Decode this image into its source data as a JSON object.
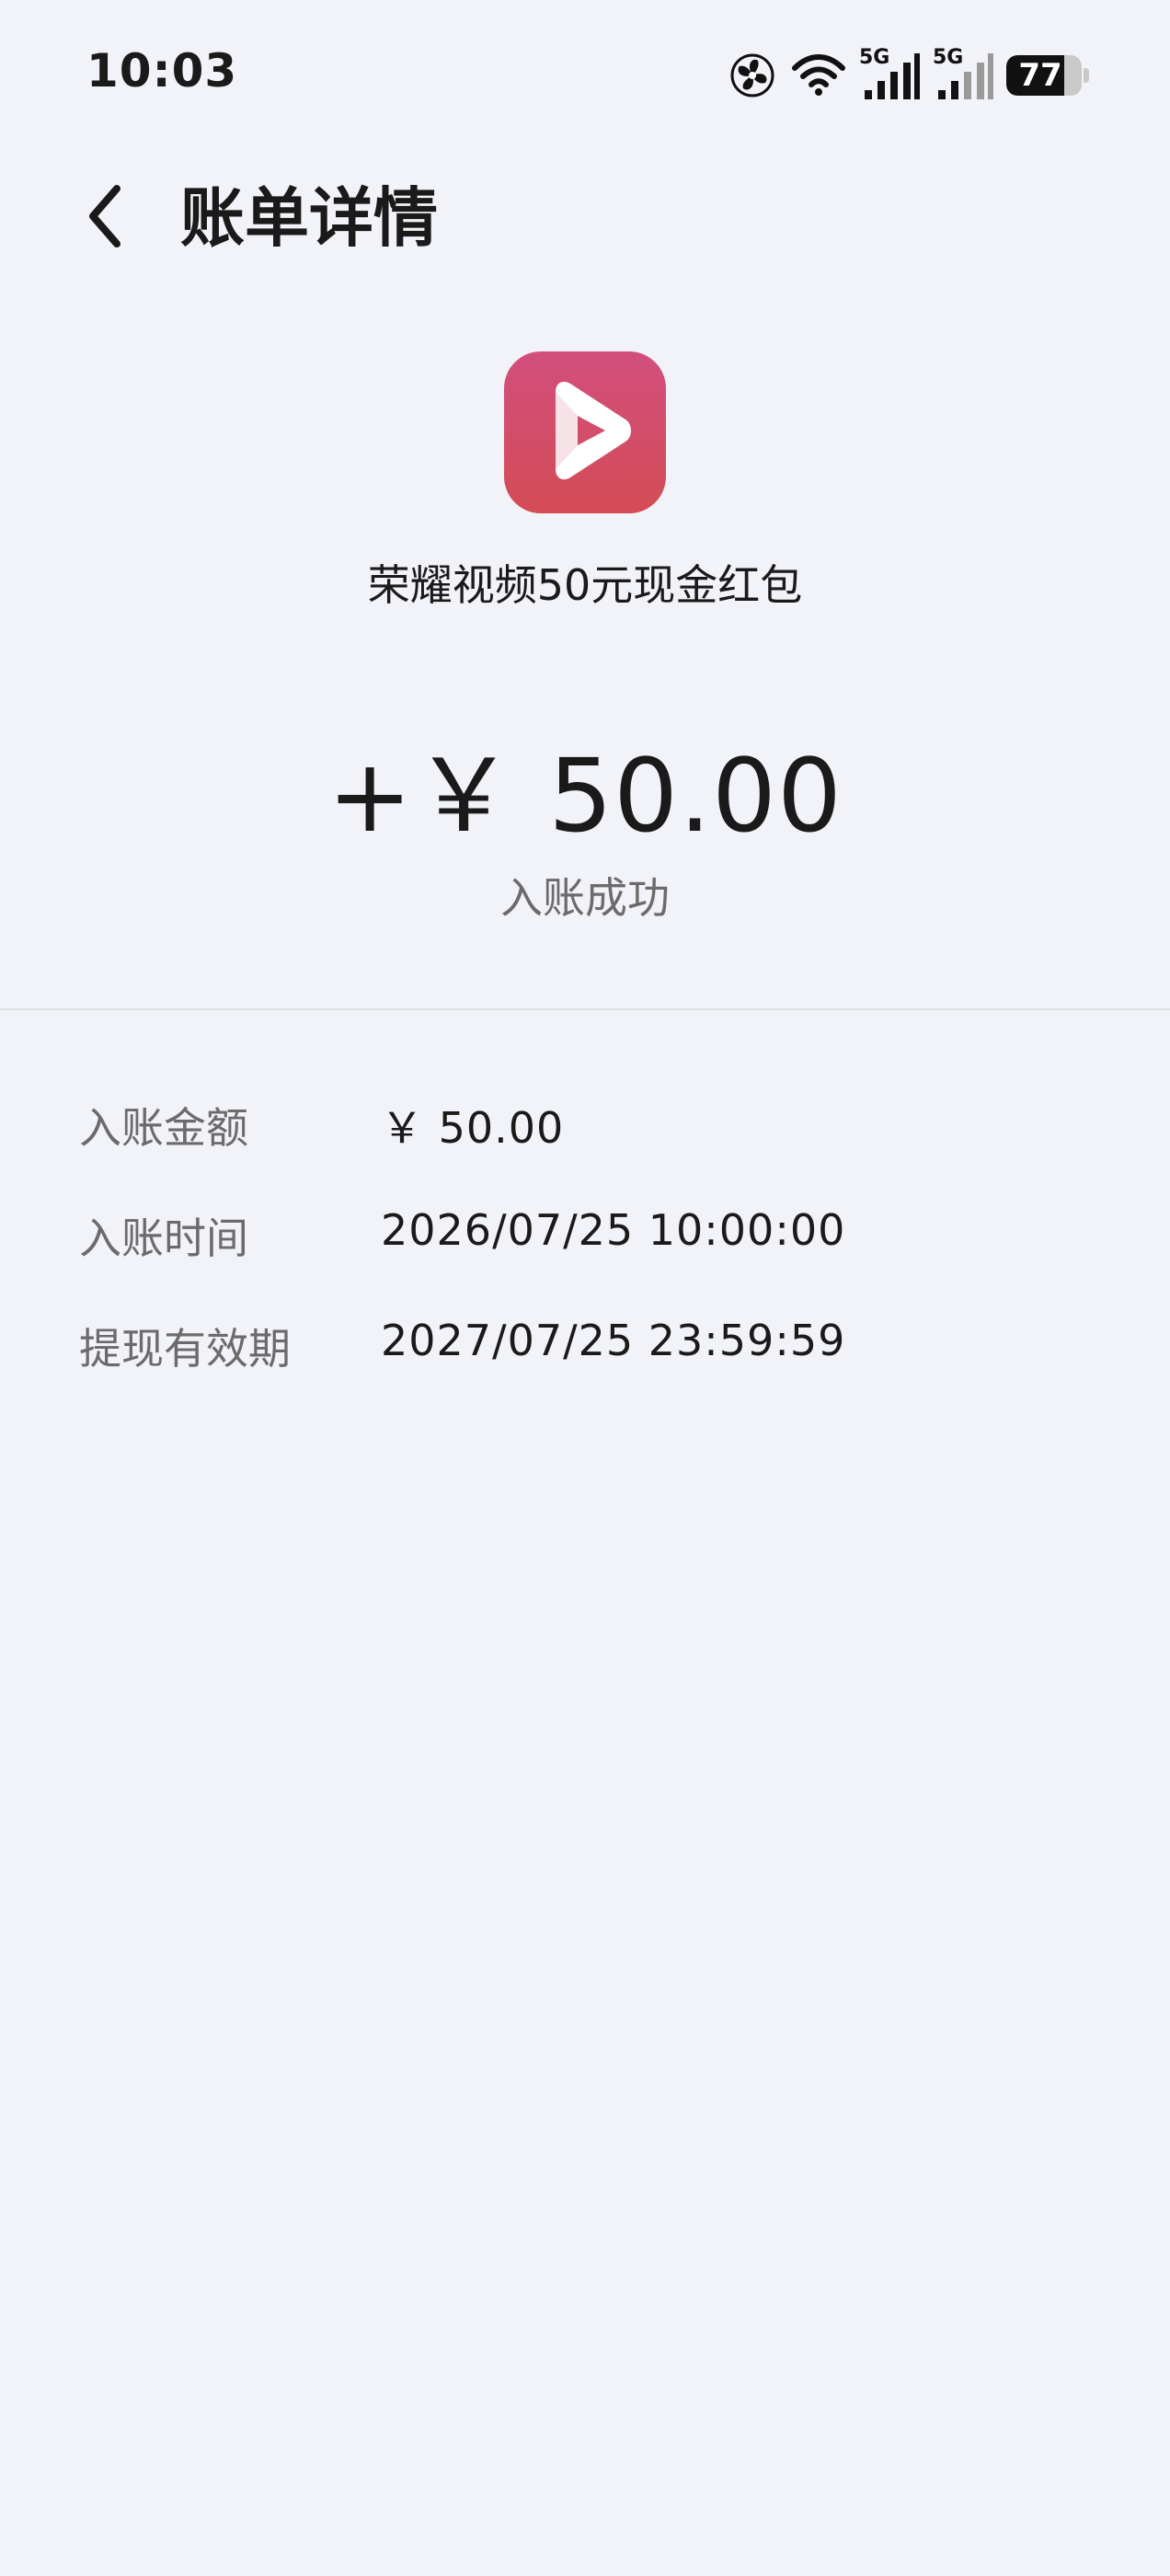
{
  "status_bar": {
    "time": "10:03",
    "network_1": "5G",
    "network_2": "5G",
    "battery": "77",
    "battery_level": 0.77,
    "icons": [
      "fan-icon",
      "wifi-icon",
      "signal-5g-icon",
      "signal-5g-icon",
      "battery-icon"
    ]
  },
  "header": {
    "title": "账单详情",
    "back_icon": "chevron-left-icon"
  },
  "transaction": {
    "app_icon": "play-video-icon",
    "app_icon_colors": [
      "#d24f7d",
      "#d34c55"
    ],
    "title": "荣耀视频50元现金红包",
    "amount": "+￥ 50.00",
    "status": "入账成功"
  },
  "details": [
    {
      "label": "入账金额",
      "value": "￥ 50.00"
    },
    {
      "label": "入账时间",
      "value": "2026/07/25 10:00:00"
    },
    {
      "label": "提现有效期",
      "value": "2027/07/25 23:59:59"
    }
  ]
}
